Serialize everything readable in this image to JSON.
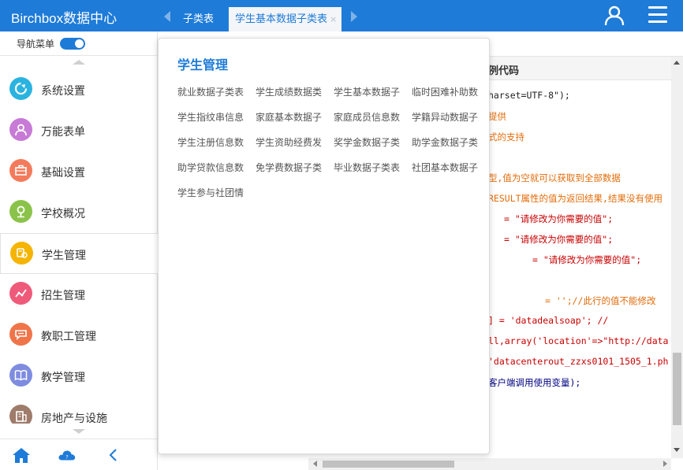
{
  "header": {
    "brand": "Birchbox数据中心",
    "tabs": [
      {
        "label": "子类表"
      },
      {
        "label": "学生基本数据子类表",
        "close": "×"
      }
    ],
    "colors": {
      "primary": "#1e7bd8"
    }
  },
  "sidebar": {
    "nav_toggle_label": "导航菜单",
    "items": [
      {
        "label": "系统设置",
        "icon": "gear-arrow-icon",
        "color": "#2bb3e0"
      },
      {
        "label": "万能表单",
        "icon": "user-icon",
        "color": "#c77ad6"
      },
      {
        "label": "基础设置",
        "icon": "briefcase-icon",
        "color": "#f37b5b"
      },
      {
        "label": "学校概况",
        "icon": "pin-icon",
        "color": "#8bc34a"
      },
      {
        "label": "学生管理",
        "icon": "student-icon",
        "color": "#f5b400"
      },
      {
        "label": "招生管理",
        "icon": "chart-line-icon",
        "color": "#ef5a7b"
      },
      {
        "label": "教职工管理",
        "icon": "chat-icon",
        "color": "#f0744a"
      },
      {
        "label": "教学管理",
        "icon": "book-icon",
        "color": "#7e8ce0"
      },
      {
        "label": "房地产与设施",
        "icon": "building-icon",
        "color": "#9e7b6a"
      }
    ]
  },
  "content": {
    "header_text": "例代码",
    "code_lines": [
      {
        "text": "harset=UTF-8\");",
        "cls": "c-black"
      },
      {
        "text": "提供",
        "cls": "c-orange"
      },
      {
        "text": "式的支持",
        "cls": "c-orange"
      },
      {
        "text": "型,值为空就可以获取到全部数据",
        "cls": "c-orange"
      },
      {
        "text": "RESULT属性的值为返回结果,结果没有使用",
        "cls": "c-orange"
      },
      {
        "text": "= \"请修改为你需要的值\";",
        "cls": "c-red"
      },
      {
        "text": "= \"请修改为你需要的值\";",
        "cls": "c-red"
      },
      {
        "text": "= \"请修改为你需要的值\";",
        "cls": "c-red"
      },
      {
        "text": "= '';//此行的值不能修改",
        "cls": "c-orange"
      },
      {
        "text": "]        = 'datadealsoap';    //",
        "cls": "c-red"
      },
      {
        "text": "ll,array('location'=>\"http://data",
        "cls": "c-red"
      },
      {
        "text": "'datacenterout_zzxs0101_1505_1.ph",
        "cls": "c-red"
      },
      {
        "text": "客户端调用使用变量);",
        "cls": "c-navy"
      }
    ]
  },
  "flyout": {
    "title": "学生管理",
    "items": [
      "就业数据子类表",
      "学生成绩数据类",
      "学生基本数据子",
      "临时困难补助数",
      "学生指纹串信息",
      "家庭基本数据子",
      "家庭成员信息数",
      "学籍异动数据子",
      "学生注册信息数",
      "学生资助经费发",
      "奖学金数据子类",
      "助学金数据子类",
      "助学贷款信息数",
      "免学费数据子类",
      "毕业数据子类表",
      "社团基本数据子",
      "学生参与社团情"
    ]
  }
}
